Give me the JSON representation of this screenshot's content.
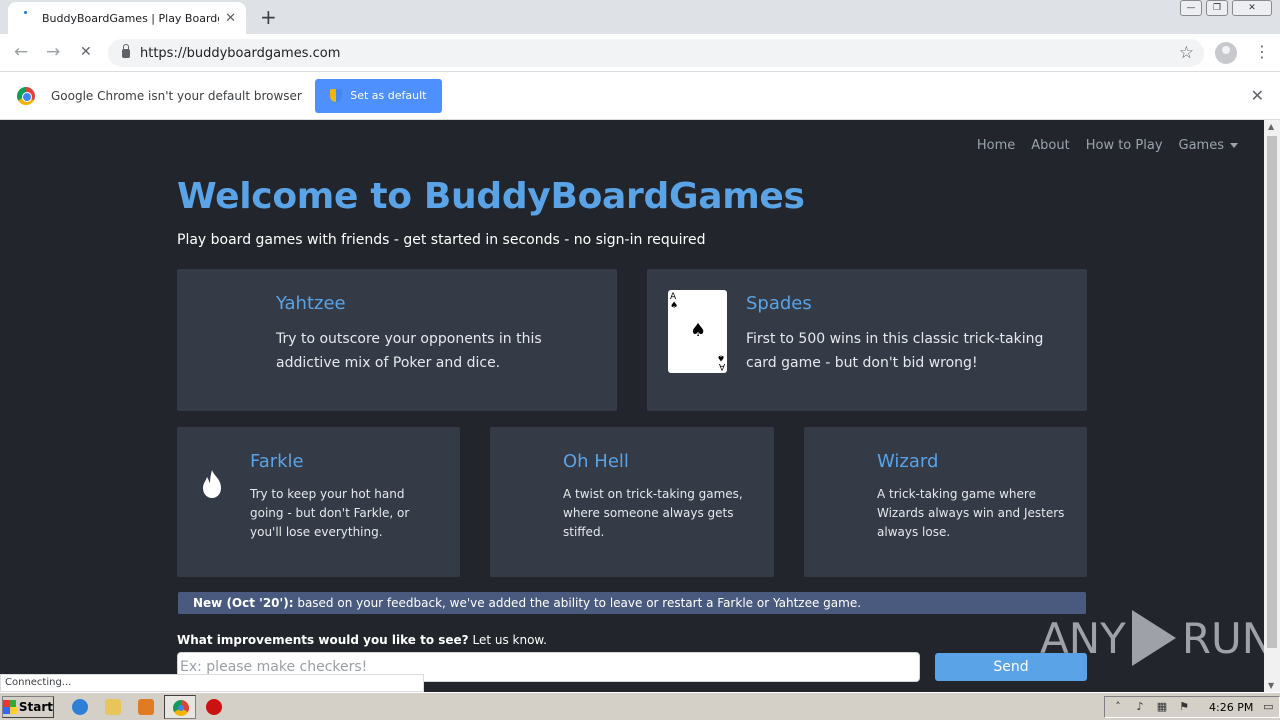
{
  "browser": {
    "tab_title": "BuddyBoardGames | Play Boardgame",
    "tab_close": "✕",
    "new_tab": "+",
    "url": "https://buddyboardgames.com",
    "window_controls": {
      "minimize": "—",
      "restore": "❐",
      "close": "✕"
    },
    "back_icon": "←",
    "forward_icon": "→",
    "reload_icon": "✕",
    "star_icon": "☆",
    "menu_icon": "⋮",
    "status": "Connecting..."
  },
  "infobar": {
    "message": "Google Chrome isn't your default browser",
    "button_label": "Set as default",
    "close_icon": "✕"
  },
  "nav": {
    "items": [
      "Home",
      "About",
      "How to Play",
      "Games"
    ]
  },
  "hero": {
    "title": "Welcome to BuddyBoardGames",
    "tagline": "Play board games with friends - get started in seconds - no sign-in required"
  },
  "games": [
    {
      "title": "Yahtzee",
      "desc": "Try to outscore your opponents in this addictive mix of Poker and dice."
    },
    {
      "title": "Spades",
      "desc": "First to 500 wins in this classic trick-taking card game - but don't bid wrong!",
      "card_rank": "A",
      "card_suit": "♠"
    },
    {
      "title": "Farkle",
      "desc": "Try to keep your hot hand going - but don't Farkle, or you'll lose everything."
    },
    {
      "title": "Oh Hell",
      "desc": "A twist on trick-taking games, where someone always gets stiffed."
    },
    {
      "title": "Wizard",
      "desc": "A trick-taking game where Wizards always win and Jesters always lose."
    }
  ],
  "announcement": {
    "label": "New (Oct '20'):",
    "text": "based on your feedback, we've added the ability to leave or restart a Farkle or Yahtzee game."
  },
  "feedback": {
    "question": "What improvements would you like to see?",
    "suffix": "Let us know.",
    "placeholder": "Ex: please make checkers!",
    "send_label": "Send"
  },
  "watermark": {
    "left": "ANY",
    "right": "RUN"
  },
  "taskbar": {
    "start_label": "Start",
    "time": "4:26 PM"
  },
  "colors": {
    "accent": "#5aa3e6",
    "page_bg": "#22262c",
    "card_bg": "#343a46",
    "announce_bg": "#4a5a7e"
  }
}
